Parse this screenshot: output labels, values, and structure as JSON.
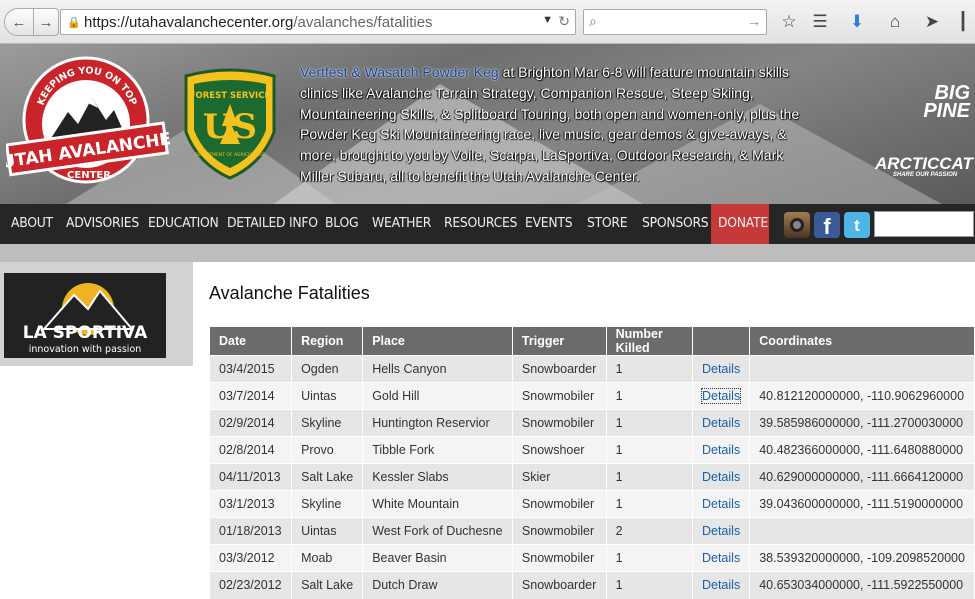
{
  "browser": {
    "url_host": "https://utahavalanchecenter.org",
    "url_path": "/avalanches/fatalities"
  },
  "banner": {
    "uac_logo": {
      "arc_text": "KEEPING YOU ON TOP",
      "name": "UTAH AVALANCHE",
      "sub": "CENTER"
    },
    "fs_logo": {
      "top_text": "FOREST SERVICE",
      "letters": "US",
      "bottom_text": "DEPARTMENT OF AGRICULTURE"
    },
    "promo_link": "Vertfest & Wasatch Powder Keg",
    "promo_text": " at Brighton Mar 6-8 will feature mountain skills clinics like Avalanche Terrain Strategy, Companion Rescue, Steep Skiing, Mountaineering Skills, & Splitboard Touring, both open and women-only, plus the Powder Keg Ski Mountaineering race, live music, gear demos & give-aways, & more, brought to you by Voile, Scarpa, LaSportiva, Outdoor Research, & Mark Miller Subaru, all to benefit the Utah Avalanche Center.",
    "bigpine_line1": "BIG",
    "bigpine_line2": "PINE",
    "arcticcat": "ARCTICCAT",
    "arcticcat_tag": "SHARE OUR PASSION"
  },
  "nav": {
    "about": "ABOUT",
    "advisories": "ADVISORIES",
    "education": "EDUCATION",
    "detailed_info": "DETAILED INFO",
    "blog": "BLOG",
    "weather": "WEATHER",
    "resources": "RESOURCES",
    "events": "EVENTS",
    "store": "STORE",
    "sponsors": "SPONSORS",
    "donate": "DONATE"
  },
  "sidebar": {
    "sponsor_name": "LA SPORTIVA",
    "sponsor_tagline": "innovation with passion"
  },
  "main": {
    "title": "Avalanche Fatalities",
    "columns": [
      "Date",
      "Region",
      "Place",
      "Trigger",
      "Number Killed",
      "",
      "Coordinates"
    ],
    "details_label": "Details",
    "rows": [
      {
        "date": "03/4/2015",
        "region": "Ogden",
        "place": "Hells Canyon",
        "trigger": "Snowboarder",
        "killed": "1",
        "coords": ""
      },
      {
        "date": "03/7/2014",
        "region": "Uintas",
        "place": "Gold Hill",
        "trigger": "Snowmobiler",
        "killed": "1",
        "coords": "40.812120000000, -110.9062960000"
      },
      {
        "date": "02/9/2014",
        "region": "Skyline",
        "place": "Huntington Reservior",
        "trigger": "Snowmobiler",
        "killed": "1",
        "coords": "39.585986000000, -111.2700030000"
      },
      {
        "date": "02/8/2014",
        "region": "Provo",
        "place": "Tibble Fork",
        "trigger": "Snowshoer",
        "killed": "1",
        "coords": "40.482366000000, -111.6480880000"
      },
      {
        "date": "04/11/2013",
        "region": "Salt Lake",
        "place": "Kessler Slabs",
        "trigger": "Skier",
        "killed": "1",
        "coords": "40.629000000000, -111.6664120000"
      },
      {
        "date": "03/1/2013",
        "region": "Skyline",
        "place": "White Mountain",
        "trigger": "Snowmobiler",
        "killed": "1",
        "coords": "39.043600000000, -111.5190000000"
      },
      {
        "date": "01/18/2013",
        "region": "Uintas",
        "place": "West Fork of Duchesne",
        "trigger": "Snowmobiler",
        "killed": "2",
        "coords": ""
      },
      {
        "date": "03/3/2012",
        "region": "Moab",
        "place": "Beaver Basin",
        "trigger": "Snowmobiler",
        "killed": "1",
        "coords": "38.539320000000, -109.2098520000"
      },
      {
        "date": "02/23/2012",
        "region": "Salt Lake",
        "place": "Dutch Draw",
        "trigger": "Snowboarder",
        "killed": "1",
        "coords": "40.653034000000, -111.5922550000"
      }
    ]
  },
  "colors": {
    "nav_bg": "#262626",
    "donate_bg": "#c6393b",
    "table_header": "#6b6b6b",
    "link": "#1a5fa8"
  },
  "icons": [
    "back-arrow-icon",
    "forward-arrow-icon",
    "lock-icon",
    "search-icon",
    "bookmark-star-icon",
    "reading-list-icon",
    "download-icon",
    "home-icon",
    "send-icon",
    "instagram-icon",
    "facebook-icon",
    "twitter-icon"
  ]
}
